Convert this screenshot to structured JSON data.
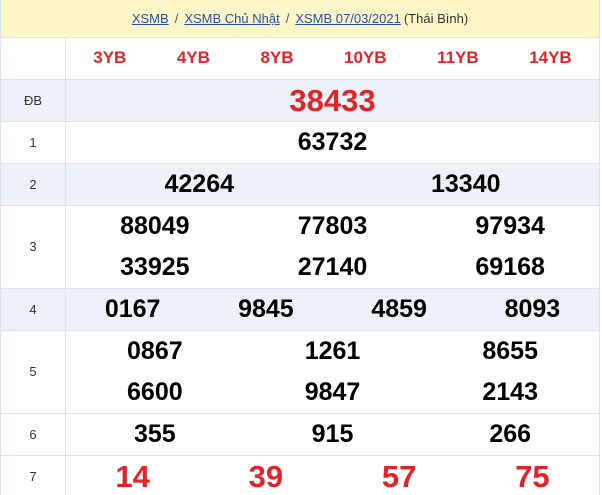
{
  "breadcrumb": {
    "link1": "XSMB",
    "link2": "XSMB Chủ Nhật",
    "link3": "XSMB 07/03/2021",
    "province": "(Thái Bình)",
    "separator": "/"
  },
  "codes": [
    "3YB",
    "4YB",
    "8YB",
    "10YB",
    "11YB",
    "14YB"
  ],
  "rows": {
    "special": {
      "label": "ĐB",
      "numbers": [
        "38433"
      ]
    },
    "g1": {
      "label": "1",
      "numbers": [
        "63732"
      ]
    },
    "g2": {
      "label": "2",
      "numbers": [
        "42264",
        "13340"
      ]
    },
    "g3": {
      "label": "3",
      "numbers": [
        "88049",
        "77803",
        "97934",
        "33925",
        "27140",
        "69168"
      ]
    },
    "g4": {
      "label": "4",
      "numbers": [
        "0167",
        "9845",
        "4859",
        "8093"
      ]
    },
    "g5": {
      "label": "5",
      "numbers": [
        "0867",
        "1261",
        "8655",
        "6600",
        "9847",
        "2143"
      ]
    },
    "g6": {
      "label": "6",
      "numbers": [
        "355",
        "915",
        "266"
      ]
    },
    "g7": {
      "label": "7",
      "numbers": [
        "14",
        "39",
        "57",
        "75"
      ]
    }
  },
  "colors": {
    "accent_red": "#e32329",
    "link_blue": "#2a4fa3",
    "header_bg": "#fff6c8",
    "alt_row_bg": "#edf2fa"
  }
}
